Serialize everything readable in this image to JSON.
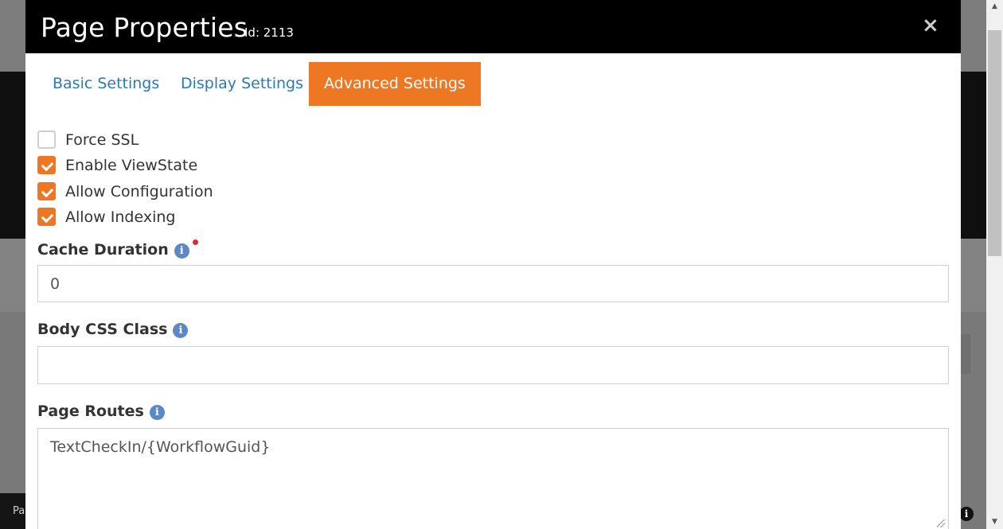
{
  "background": {
    "bottom_bar_text": "Pa",
    "info_icon_glyph": "i"
  },
  "modal": {
    "title": "Page Properties",
    "id_label": "Id: 2113",
    "close_glyph": "×"
  },
  "tabs": [
    {
      "label": "Basic Settings",
      "active": false
    },
    {
      "label": "Display Settings",
      "active": false
    },
    {
      "label": "Advanced Settings",
      "active": true
    }
  ],
  "checkboxes": [
    {
      "label": "Force SSL",
      "checked": false
    },
    {
      "label": "Enable ViewState",
      "checked": true
    },
    {
      "label": "Allow Configuration",
      "checked": true
    },
    {
      "label": "Allow Indexing",
      "checked": true
    }
  ],
  "fields": {
    "cache_duration": {
      "label": "Cache Duration",
      "value": "0",
      "required": true,
      "info_glyph": "i"
    },
    "body_css_class": {
      "label": "Body CSS Class",
      "value": "",
      "info_glyph": "i"
    },
    "page_routes": {
      "label": "Page Routes",
      "value": "TextCheckIn/{WorkflowGuid}",
      "info_glyph": "i"
    }
  },
  "colors": {
    "accent": "#ee7724",
    "link": "#2a7ab8",
    "info_icon": "#5b88c7",
    "required": "#d32f2f"
  },
  "icons": [
    "close-icon",
    "info-icon",
    "checkmark-icon",
    "resize-handle-icon"
  ]
}
